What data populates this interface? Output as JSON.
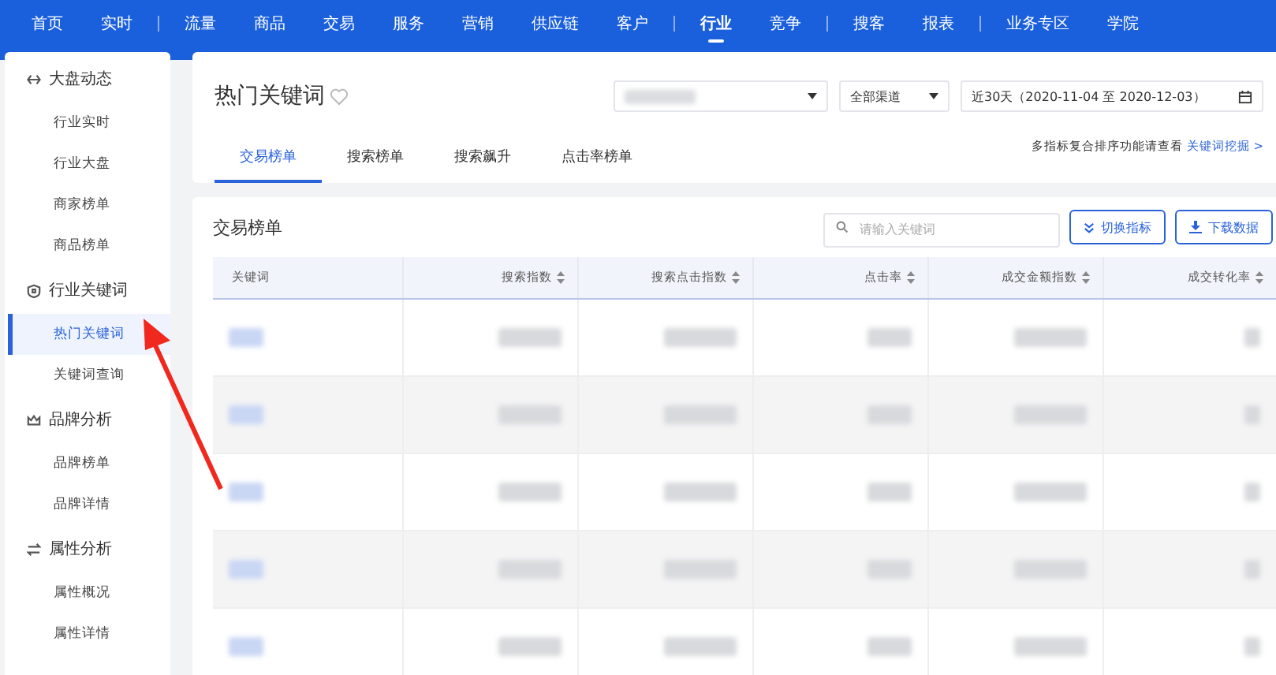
{
  "nav": [
    {
      "label": "首页",
      "selected": false,
      "divider_after": false
    },
    {
      "label": "实时",
      "selected": false,
      "divider_after": true
    },
    {
      "label": "流量",
      "selected": false,
      "divider_after": false
    },
    {
      "label": "商品",
      "selected": false,
      "divider_after": false
    },
    {
      "label": "交易",
      "selected": false,
      "divider_after": false
    },
    {
      "label": "服务",
      "selected": false,
      "divider_after": false
    },
    {
      "label": "营销",
      "selected": false,
      "divider_after": false
    },
    {
      "label": "供应链",
      "selected": false,
      "divider_after": false
    },
    {
      "label": "客户",
      "selected": false,
      "divider_after": true
    },
    {
      "label": "行业",
      "selected": true,
      "divider_after": false
    },
    {
      "label": "竞争",
      "selected": false,
      "divider_after": true
    },
    {
      "label": "搜客",
      "selected": false,
      "divider_after": false
    },
    {
      "label": "报表",
      "selected": false,
      "divider_after": true
    },
    {
      "label": "业务专区",
      "selected": false,
      "divider_after": false
    },
    {
      "label": "学院",
      "selected": false,
      "divider_after": false
    }
  ],
  "sidebar": [
    {
      "title": "大盘动态",
      "items": [
        {
          "label": "行业实时",
          "selected": false
        },
        {
          "label": "行业大盘",
          "selected": false
        },
        {
          "label": "商家榜单",
          "selected": false
        },
        {
          "label": "商品榜单",
          "selected": false
        }
      ]
    },
    {
      "title": "行业关键词",
      "items": [
        {
          "label": "热门关键词",
          "selected": true
        },
        {
          "label": "关键词查询",
          "selected": false
        }
      ]
    },
    {
      "title": "品牌分析",
      "items": [
        {
          "label": "品牌榜单",
          "selected": false
        },
        {
          "label": "品牌详情",
          "selected": false
        }
      ]
    },
    {
      "title": "属性分析",
      "items": [
        {
          "label": "属性概况",
          "selected": false
        },
        {
          "label": "属性详情",
          "selected": false
        }
      ]
    }
  ],
  "page": {
    "title": "热门关键词",
    "channel": "全部渠道",
    "date_range": "近30天（2020-11-04 至 2020-12-03）",
    "tabs": [
      {
        "label": "交易榜单",
        "selected": true
      },
      {
        "label": "搜索榜单",
        "selected": false
      },
      {
        "label": "搜索飙升",
        "selected": false
      },
      {
        "label": "点击率榜单",
        "selected": false
      }
    ],
    "hint": "多指标复合排序功能请查看",
    "hint_link": "关键词挖掘 >"
  },
  "table": {
    "title": "交易榜单",
    "search_placeholder": "请输入关键词",
    "buttons": [
      "切换指标",
      "下载数据"
    ],
    "columns": [
      "关键词",
      "搜索指数",
      "搜索点击指数",
      "点击率",
      "成交金额指数",
      "成交转化率"
    ]
  }
}
